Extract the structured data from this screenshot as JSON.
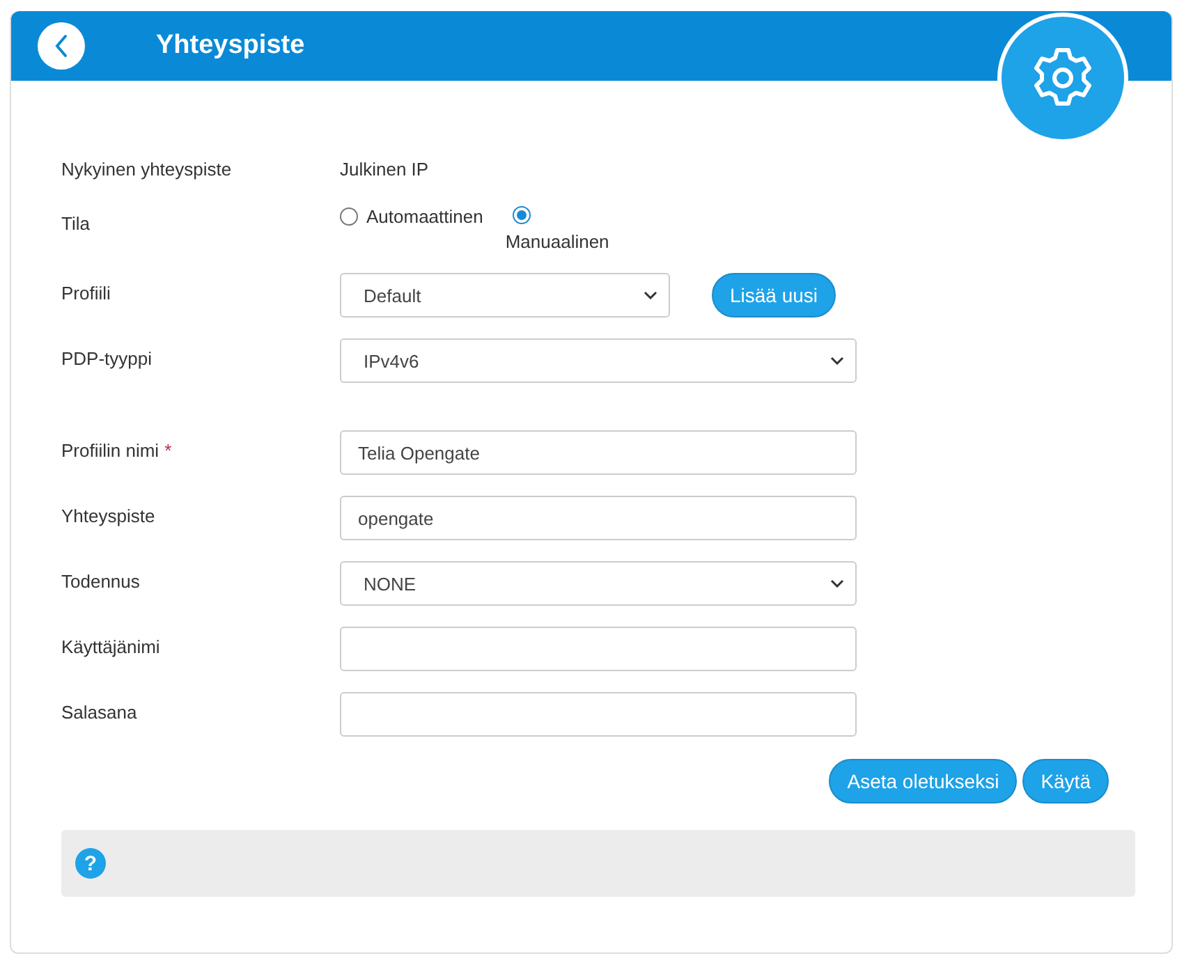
{
  "header": {
    "title": "Yhteyspiste"
  },
  "sections": [
    {
      "rows": [
        {
          "kind": "text",
          "label": "Nykyinen yhteyspiste",
          "value": "Julkinen IP"
        },
        {
          "kind": "radio",
          "label": "Tila",
          "options": [
            {
              "label": "Automaattinen",
              "selected": false
            },
            {
              "label": "Manuaalinen",
              "selected": true
            }
          ]
        },
        {
          "kind": "select",
          "label": "Profiili",
          "value": "Default",
          "narrow": true,
          "button": "Lisää uusi"
        },
        {
          "kind": "select",
          "label": "PDP-tyyppi",
          "value": "IPv4v6"
        }
      ]
    },
    {
      "rows": [
        {
          "kind": "input",
          "label": "Profiilin nimi",
          "required_mark": "*",
          "value": "Telia Opengate"
        },
        {
          "kind": "input",
          "label": "Yhteyspiste",
          "value": "opengate"
        },
        {
          "kind": "select",
          "label": "Todennus",
          "value": "NONE"
        },
        {
          "kind": "input",
          "label": "Käyttäjänimi",
          "value": ""
        },
        {
          "kind": "input",
          "label": "Salasana",
          "value": ""
        }
      ]
    }
  ],
  "buttons": [
    "Aseta oletukseksi",
    "Käytä"
  ],
  "help": {
    "icon": "?"
  }
}
